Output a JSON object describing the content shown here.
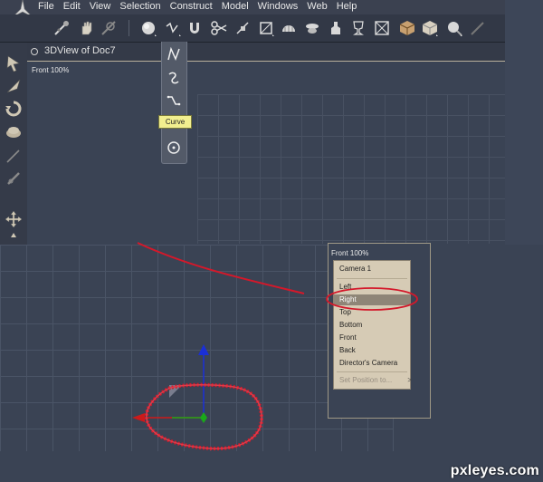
{
  "menubar": {
    "items": [
      "File",
      "Edit",
      "View",
      "Selection",
      "Construct",
      "Model",
      "Windows",
      "Web",
      "Help"
    ]
  },
  "toolbar": {
    "icons": [
      "pivot-tool-icon",
      "hand-tool-icon",
      "scale-tool-icon",
      "sphere-primitive-icon",
      "curve-tool-icon",
      "magnet-tool-icon",
      "scissors-tool-icon",
      "lathe-tool-icon",
      "bevel-tool-icon",
      "shape-tool-icon",
      "smooth-tool-icon",
      "bezier-tool-icon",
      "trophy-icon",
      "cross-box-icon",
      "cube-icon",
      "cube-tex-icon",
      "light-icon",
      "wand-icon"
    ]
  },
  "view": {
    "title": "3DView of Doc7",
    "front_label": "Front 100%"
  },
  "tooltip": {
    "text": "Curve"
  },
  "context_panel": {
    "header": "Front 100%",
    "items": [
      {
        "label": "Camera 1",
        "state": "normal"
      },
      {
        "label": "Left",
        "state": "normal"
      },
      {
        "label": "Right",
        "state": "selected"
      },
      {
        "label": "Top",
        "state": "normal"
      },
      {
        "label": "Bottom",
        "state": "normal"
      },
      {
        "label": "Front",
        "state": "normal"
      },
      {
        "label": "Back",
        "state": "normal"
      },
      {
        "label": "Director's Camera",
        "state": "normal"
      },
      {
        "label": "Set Position to...",
        "state": "disabled",
        "submenu": ">"
      }
    ]
  },
  "colors": {
    "annotation_red": "#d4182a",
    "axis_blue": "#1a2fd6",
    "axis_green": "#1aa81a",
    "axis_red": "#cc1a1a"
  },
  "watermark": "pxleyes.com"
}
